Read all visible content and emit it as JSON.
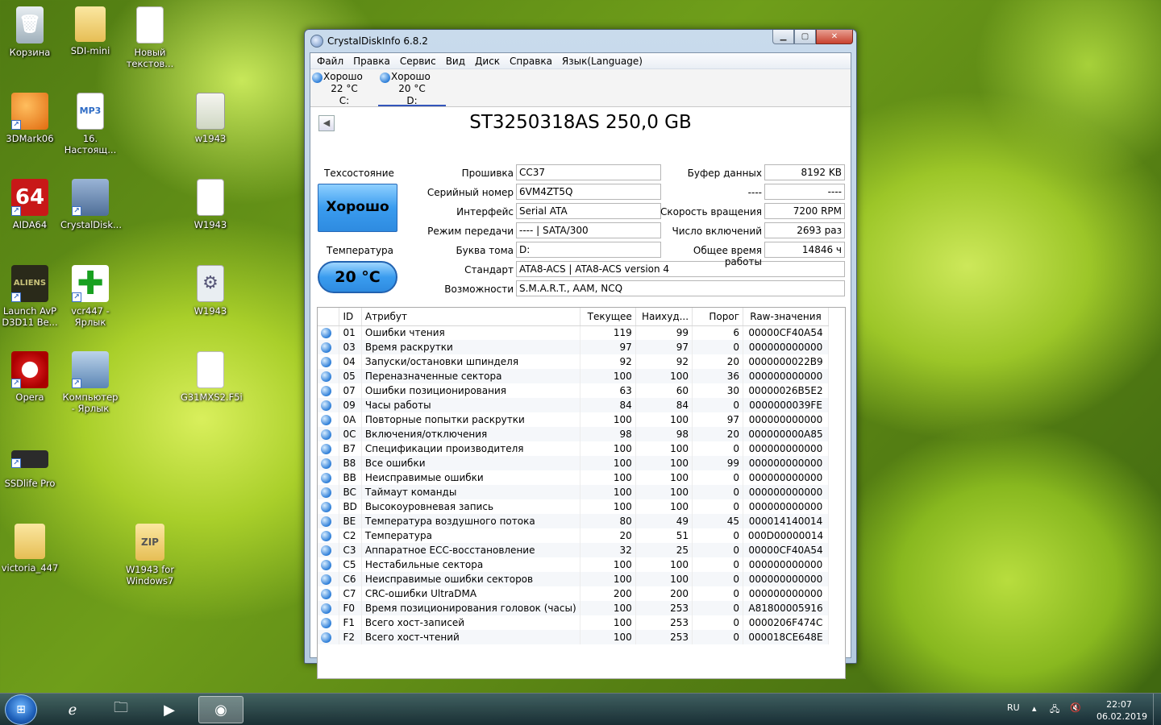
{
  "desktop": {
    "icons": [
      {
        "label": "Корзина",
        "glyph": "🗑"
      },
      {
        "label": "SDI-mini",
        "glyph": ""
      },
      {
        "label": "Новый текстов...",
        "glyph": ""
      },
      {
        "label": "3DMark06",
        "glyph": ""
      },
      {
        "label": "16. Настоящ...",
        "glyph": "MP3"
      },
      {
        "label": "w1943",
        "glyph": ""
      },
      {
        "label": "AIDA64",
        "glyph": "64"
      },
      {
        "label": "CrystalDisk...",
        "glyph": ""
      },
      {
        "label": "W1943",
        "glyph": "▲"
      },
      {
        "label": "Launch AvP D3D11 Be...",
        "glyph": "ALIENS"
      },
      {
        "label": "vcr447 - Ярлык",
        "glyph": "✚"
      },
      {
        "label": "W1943",
        "glyph": "⚙"
      },
      {
        "label": "Opera",
        "glyph": ""
      },
      {
        "label": "Компьютер - Ярлык",
        "glyph": ""
      },
      {
        "label": "G31MXS2.F5i",
        "glyph": ""
      },
      {
        "label": "SSDlife Pro",
        "glyph": ""
      },
      {
        "label": "victoria_447",
        "glyph": ""
      },
      {
        "label": "W1943 for Windows7",
        "glyph": "ZIP"
      }
    ]
  },
  "window": {
    "title": "CrystalDiskInfo 6.8.2",
    "menu": [
      "Файл",
      "Правка",
      "Сервис",
      "Вид",
      "Диск",
      "Справка",
      "Язык(Language)"
    ],
    "drives": [
      {
        "status": "Хорошо",
        "temp": "22 °C",
        "letter": "C:"
      },
      {
        "status": "Хорошо",
        "temp": "20 °C",
        "letter": "D:"
      }
    ],
    "model": "ST3250318AS 250,0 GB",
    "health_label": "Техсостояние",
    "health_value": "Хорошо",
    "temp_label": "Температура",
    "temp_value": "20 °C",
    "info": {
      "firmware_label": "Прошивка",
      "firmware": "CC37",
      "serial_label": "Серийный номер",
      "serial": "6VM4ZT5Q",
      "interface_label": "Интерфейс",
      "interface": "Serial ATA",
      "transfer_label": "Режим передачи",
      "transfer": "---- | SATA/300",
      "volume_label": "Буква тома",
      "volume": "D:",
      "standard_label": "Стандарт",
      "standard": "ATA8-ACS | ATA8-ACS version 4",
      "features_label": "Возможности",
      "features": "S.M.A.R.T., AAM, NCQ",
      "buffer_label": "Буфер данных",
      "buffer": "8192 KB",
      "blank_label": "----",
      "blank": "----",
      "rpm_label": "Скорость вращения",
      "rpm": "7200 RPM",
      "poweron_count_label": "Число включений",
      "poweron_count": "2693 раз",
      "poweron_hours_label": "Общее время работы",
      "poweron_hours": "14846 ч"
    },
    "smart_headers": [
      "ID",
      "Атрибут",
      "Текущее",
      "Наихуд...",
      "Порог",
      "Raw-значения"
    ],
    "smart_rows": [
      [
        "01",
        "Ошибки чтения",
        "119",
        "99",
        "6",
        "00000CF40A54"
      ],
      [
        "03",
        "Время раскрутки",
        "97",
        "97",
        "0",
        "000000000000"
      ],
      [
        "04",
        "Запуски/остановки шпинделя",
        "92",
        "92",
        "20",
        "0000000022B9"
      ],
      [
        "05",
        "Переназначенные сектора",
        "100",
        "100",
        "36",
        "000000000000"
      ],
      [
        "07",
        "Ошибки позиционирования",
        "63",
        "60",
        "30",
        "00000026B5E2"
      ],
      [
        "09",
        "Часы работы",
        "84",
        "84",
        "0",
        "0000000039FE"
      ],
      [
        "0A",
        "Повторные попытки раскрутки",
        "100",
        "100",
        "97",
        "000000000000"
      ],
      [
        "0C",
        "Включения/отключения",
        "98",
        "98",
        "20",
        "000000000A85"
      ],
      [
        "B7",
        "Спецификации производителя",
        "100",
        "100",
        "0",
        "000000000000"
      ],
      [
        "B8",
        "Все ошибки",
        "100",
        "100",
        "99",
        "000000000000"
      ],
      [
        "BB",
        "Неисправимые ошибки",
        "100",
        "100",
        "0",
        "000000000000"
      ],
      [
        "BC",
        "Таймаут команды",
        "100",
        "100",
        "0",
        "000000000000"
      ],
      [
        "BD",
        "Высокоуровневая запись",
        "100",
        "100",
        "0",
        "000000000000"
      ],
      [
        "BE",
        "Температура воздушного потока",
        "80",
        "49",
        "45",
        "000014140014"
      ],
      [
        "C2",
        "Температура",
        "20",
        "51",
        "0",
        "000D00000014"
      ],
      [
        "C3",
        "Аппаратное ECC-восстановление",
        "32",
        "25",
        "0",
        "00000CF40A54"
      ],
      [
        "C5",
        "Нестабильные сектора",
        "100",
        "100",
        "0",
        "000000000000"
      ],
      [
        "C6",
        "Неисправимые ошибки секторов",
        "100",
        "100",
        "0",
        "000000000000"
      ],
      [
        "C7",
        "CRC-ошибки UltraDMA",
        "200",
        "200",
        "0",
        "000000000000"
      ],
      [
        "F0",
        "Время позиционирования головок (часы)",
        "100",
        "253",
        "0",
        "A81800005916"
      ],
      [
        "F1",
        "Всего хост-записей",
        "100",
        "253",
        "0",
        "0000206F474C"
      ],
      [
        "F2",
        "Всего хост-чтений",
        "100",
        "253",
        "0",
        "000018CE648E"
      ]
    ]
  },
  "taskbar": {
    "language": "RU",
    "time": "22:07",
    "date": "06.02.2019"
  }
}
